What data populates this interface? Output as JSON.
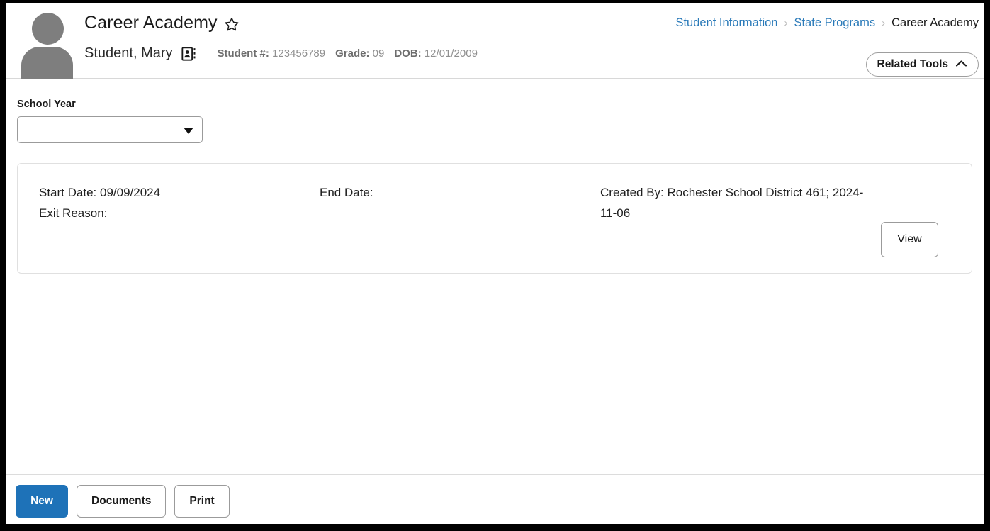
{
  "header": {
    "title": "Career Academy",
    "favorite_icon": "star-icon",
    "avatar_icon": "person-avatar-icon",
    "student_name": "Student, Mary",
    "badge_icon": "contact-card-icon",
    "student_number_label": "Student #:",
    "student_number_value": "123456789",
    "grade_label": "Grade:",
    "grade_value": "09",
    "dob_label": "DOB:",
    "dob_value": "12/01/2009"
  },
  "breadcrumb": {
    "items": [
      {
        "label": "Student Information",
        "current": false
      },
      {
        "label": "State Programs",
        "current": false
      },
      {
        "label": "Career Academy",
        "current": true
      }
    ],
    "separator": "›"
  },
  "related_tools": {
    "label": "Related Tools",
    "chevron_icon": "chevron-up-icon"
  },
  "filters": {
    "school_year_label": "School Year",
    "school_year_value": "",
    "school_year_placeholder": "",
    "dropdown_icon": "caret-down-icon"
  },
  "record": {
    "start_date_label": "Start Date:",
    "start_date_value": "09/09/2024",
    "exit_reason_label": "Exit Reason:",
    "exit_reason_value": "",
    "end_date_label": "End Date:",
    "end_date_value": "",
    "created_by_label": "Created By:",
    "created_by_value": "Rochester School District 461; 2024-11-06",
    "view_label": "View"
  },
  "footer": {
    "new_label": "New",
    "documents_label": "Documents",
    "print_label": "Print"
  },
  "colors": {
    "accent_blue": "#1e72b8",
    "link_blue": "#2a7ab9",
    "avatar_gray": "#7e7e7e",
    "meta_gray": "#8a8a8a",
    "border_gray": "#9b9b9b",
    "card_border": "#e0e0e0"
  }
}
